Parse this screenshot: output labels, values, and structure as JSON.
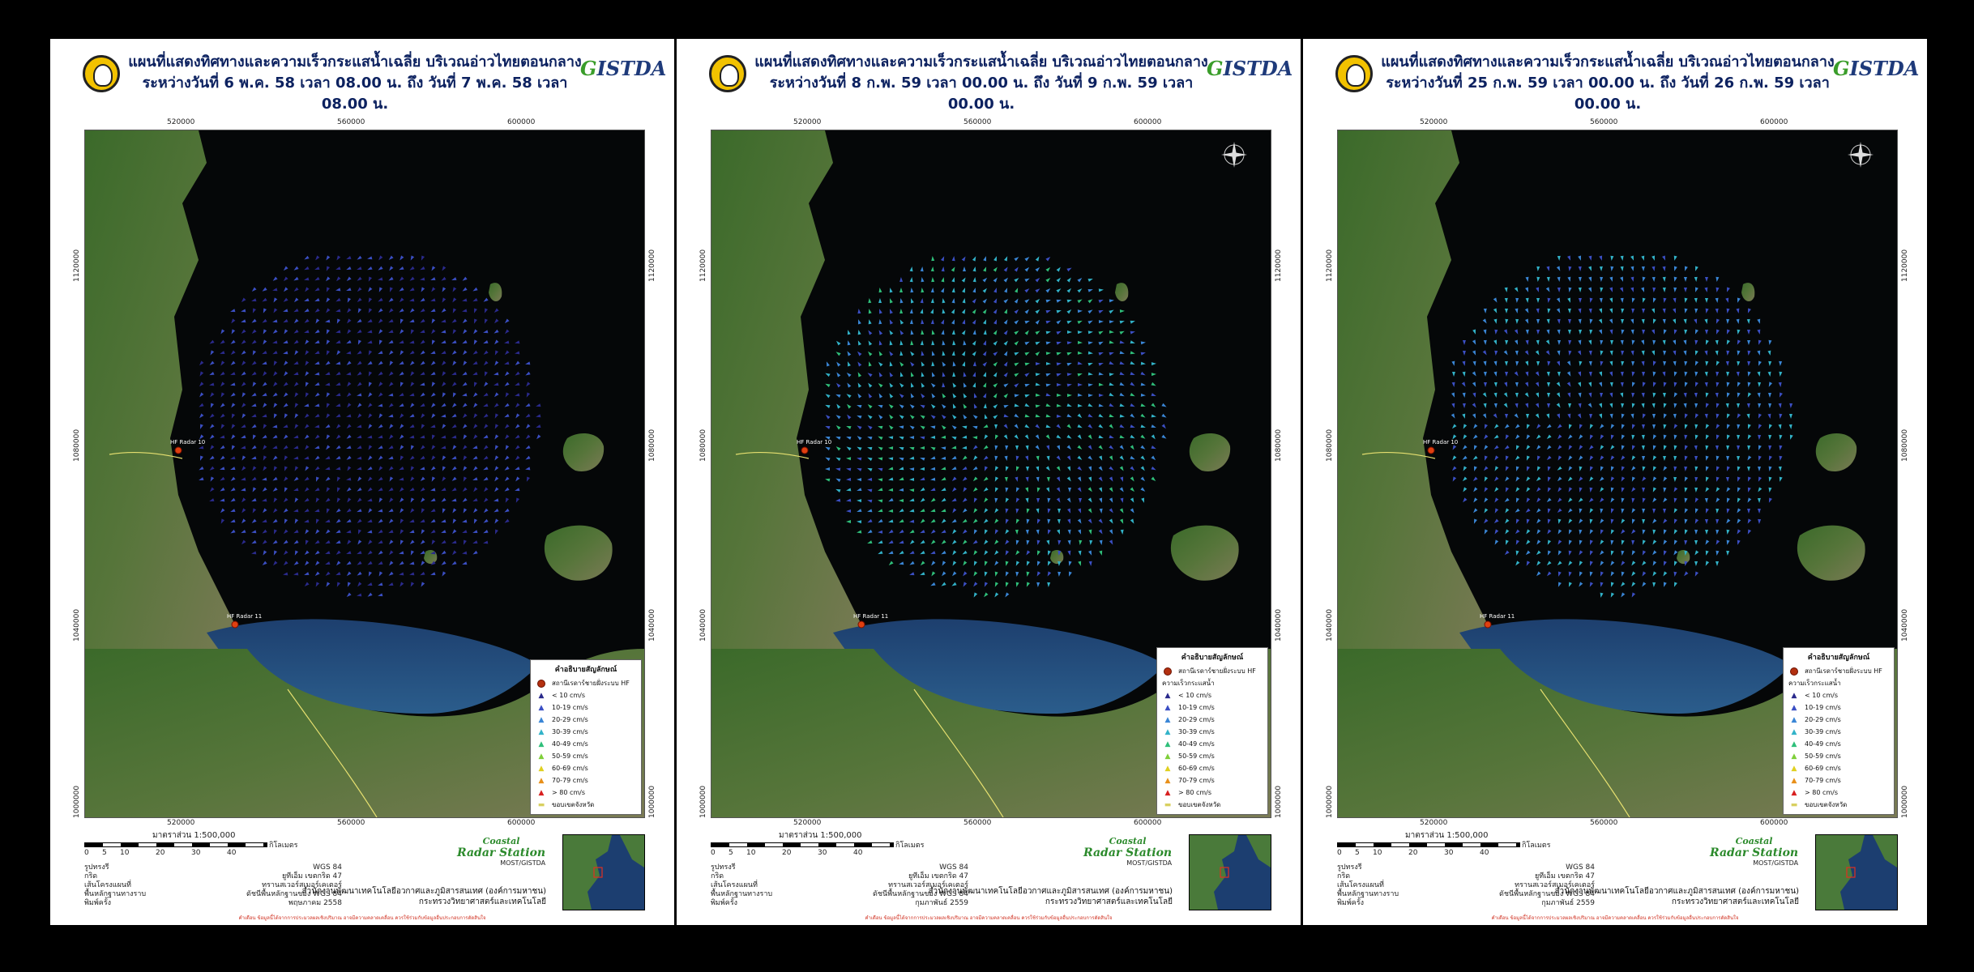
{
  "common": {
    "title_line1": "แผนที่แสดงทิศทางและความเร็วกระแสน้ำเฉลี่ย บริเวณอ่าวไทยตอนกลาง",
    "brand": "GISTDA",
    "x_ticks": [
      "520000",
      "560000",
      "600000"
    ],
    "y_ticks": [
      "1120000",
      "1080000",
      "1040000",
      "1000000"
    ],
    "radar_labels": [
      "HF Radar 10",
      "HF Radar 11"
    ],
    "legend_title": "คำอธิบายสัญลักษณ์",
    "legend_station": "สถานีเรดาร์ชายฝั่งระบบ HF",
    "legend_speed_heading": "ความเร็วกระแสน้ำ",
    "legend_speeds": [
      {
        "label": "< 10 cm/s",
        "color": "#2a2a8c"
      },
      {
        "label": "10-19 cm/s",
        "color": "#3b4fc4"
      },
      {
        "label": "20-29 cm/s",
        "color": "#3a86d6"
      },
      {
        "label": "30-39 cm/s",
        "color": "#32b3c9"
      },
      {
        "label": "40-49 cm/s",
        "color": "#2fbf7a"
      },
      {
        "label": "50-59 cm/s",
        "color": "#7fcf3a"
      },
      {
        "label": "60-69 cm/s",
        "color": "#e0d020"
      },
      {
        "label": "70-79 cm/s",
        "color": "#e8901a"
      },
      {
        "label": "> 80 cm/s",
        "color": "#d82020"
      }
    ],
    "legend_boundary": "ขอบเขตจังหวัด",
    "scale_title": "มาตราส่วน 1:500,000",
    "scale_labels": [
      "0",
      "5",
      "10",
      "20",
      "30",
      "40"
    ],
    "km_label": "กิโลเมตร",
    "meta": [
      {
        "k": "รูปทรงรี",
        "v": "WGS 84"
      },
      {
        "k": "กริด",
        "v": "ยูทีเอ็ม เขตกริด 47"
      },
      {
        "k": "เส้นโครงแผนที่",
        "v": "ทรานสเวอร์สเมอร์เคเตอร์"
      },
      {
        "k": "พื้นหลักฐานทางราบ",
        "v": "ดัชนีพื้นหลักฐานของ WGS 84"
      }
    ],
    "meta_print_key": "พิมพ์ครั้ง",
    "radar_brand_1": "Coastal",
    "radar_brand_2": "Radar Station",
    "radar_brand_3": "MOST/GISTDA",
    "agency_1": "สำนักงานพัฒนาเทคโนโลยีอวกาศและภูมิสารสนเทศ (องค์การมหาชน)",
    "agency_2": "กระทรวงวิทยาศาสตร์และเทคโนโลยี",
    "note": "คำเตือน ข้อมูลนี้ได้จากการประมวลผลเชิงปริมาณ อาจมีความคลาดเคลื่อน ควรใช้ร่วมกับข้อมูลอื่นประกอบการตัดสินใจ"
  },
  "panels": [
    {
      "title_line2": "ระหว่างวันที่ 6 พ.ค. 58 เวลา 08.00 น. ถึง วันที่ 7 พ.ค. 58 เวลา 08.00 น.",
      "print_date": "พฤษภาคม 2558"
    },
    {
      "title_line2": "ระหว่างวันที่ 8 ก.พ. 59 เวลา 00.00 น. ถึง วันที่ 9 ก.พ. 59 เวลา 00.00 น.",
      "print_date": "กุมภาพันธ์ 2559"
    },
    {
      "title_line2": "ระหว่างวันที่ 25 ก.พ. 59 เวลา 00.00 น. ถึง วันที่ 26 ก.พ. 59 เวลา 00.00 น.",
      "print_date": "กุมภาพันธ์ 2559"
    }
  ]
}
